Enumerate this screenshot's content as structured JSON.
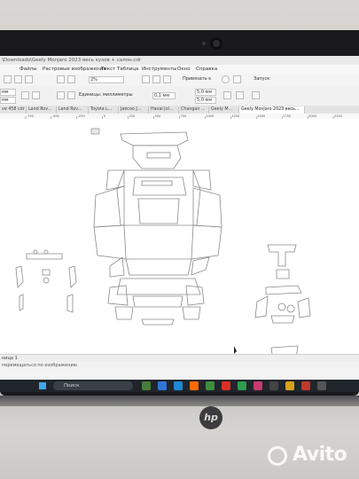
{
  "window": {
    "title": "\\Downloads\\Geely Monjaro 2023 весь кузов + салон.cdr"
  },
  "menu": {
    "items": [
      "Файлы",
      "Растровые изображения",
      "Текст",
      "Таблица",
      "Инструменты",
      "Окно",
      "Справка"
    ]
  },
  "toolbar": {
    "zoom_value": "2%",
    "snap_label": "Привязать к",
    "launch_label": "Запуск",
    "units_label": "Единицы: миллиметры",
    "nudge_value": "0,1 мм",
    "dup_x": "5,0 мм",
    "dup_y": "5,0 мм"
  },
  "tabs": [
    "ve 458 cdr",
    "Land Rov...",
    "Land Rov...",
    "Toyota L...",
    "Jaecoo J...",
    "Haval Jol...",
    "Changan ...",
    "Geely M...",
    "Geely Monjaro 2023 весь..."
  ],
  "active_tab_index": 8,
  "ruler": {
    "ticks": [
      "-750",
      "-500",
      "-250",
      "0",
      "250",
      "500",
      "750",
      "1000",
      "1250",
      "1500",
      "1750",
      "2000",
      "2250"
    ]
  },
  "page_tab": "ница 1",
  "status": "перемещаться по изображению",
  "taskbar": {
    "search_placeholder": "Поиск"
  },
  "chassis": {
    "brand_logo": "hp"
  },
  "watermark": "Avito"
}
